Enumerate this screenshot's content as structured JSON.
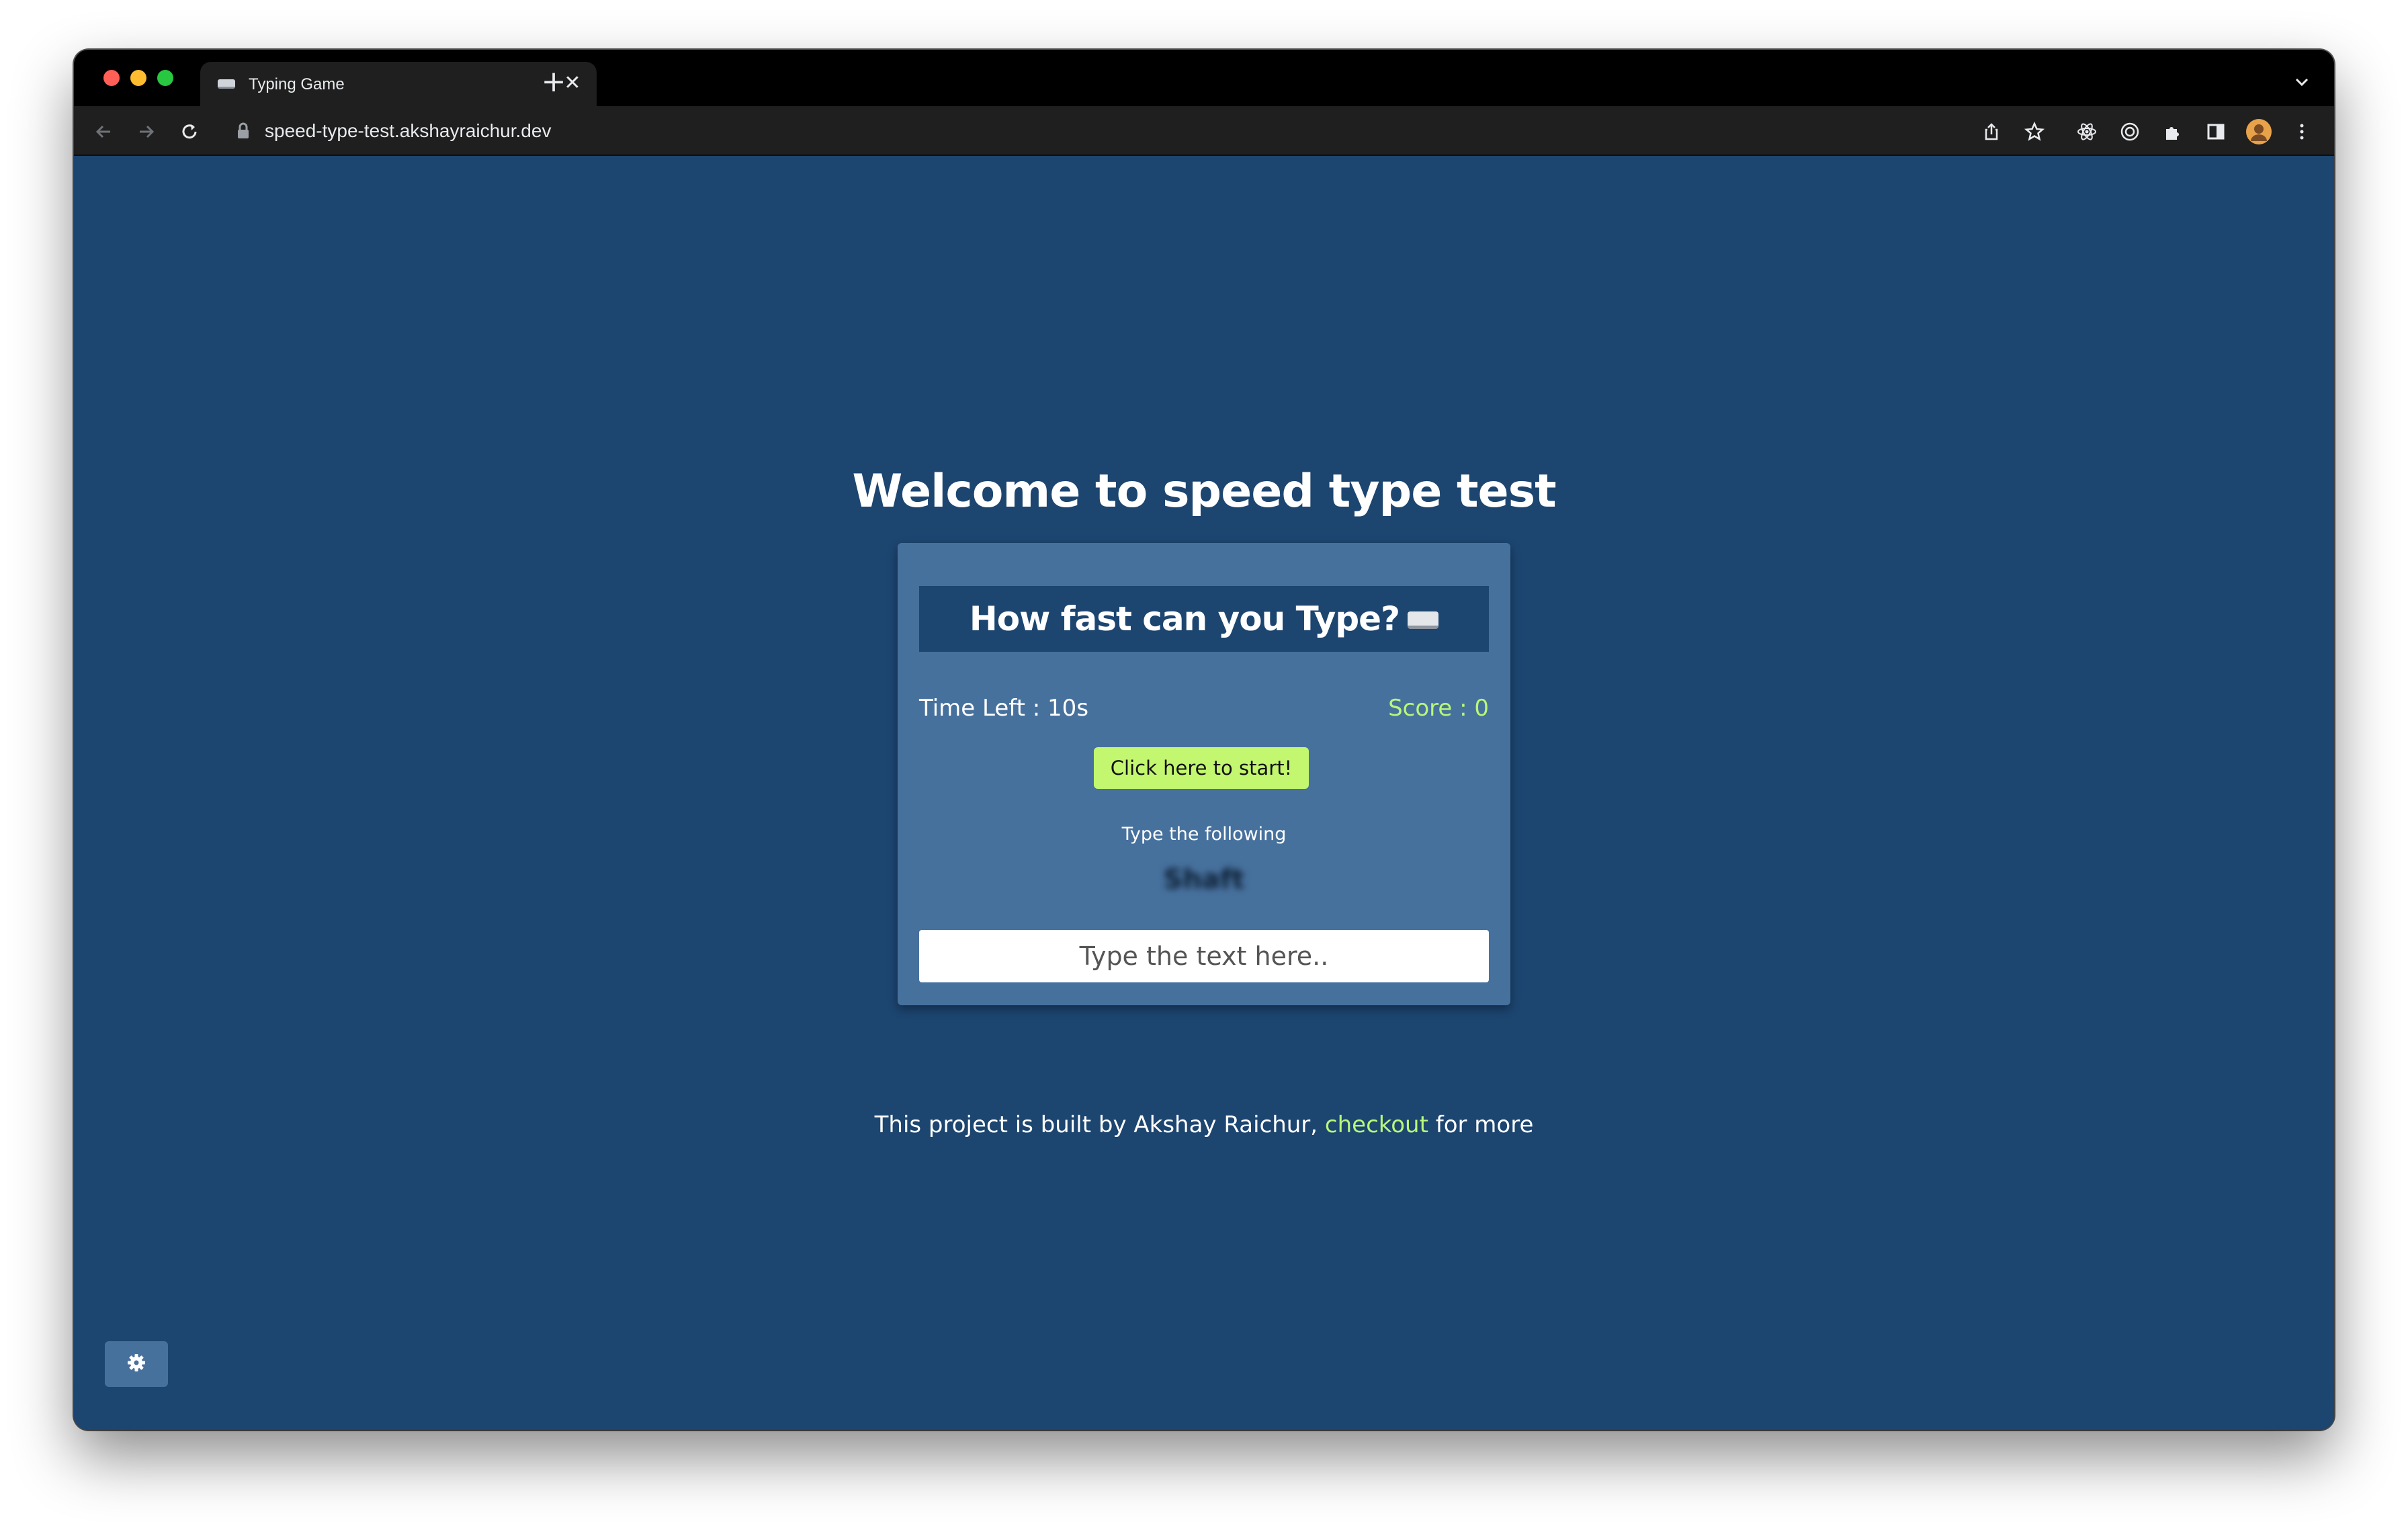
{
  "browser": {
    "tab": {
      "title": "Typing Game",
      "favicon": "keyboard-icon"
    },
    "address_bar": {
      "url": "speed-type-test.akshayraichur.dev"
    }
  },
  "page": {
    "heading": "Welcome to speed type test",
    "card": {
      "title": "How fast can you Type?",
      "title_icon": "keyboard-icon",
      "time_left": "Time Left : 10s",
      "score": "Score : 0",
      "start_button": "Click here to start!",
      "instruction": "Type the following",
      "target_word": "Shaft",
      "input_placeholder": "Type the text here.."
    },
    "footer": {
      "prefix": "This project is built by Akshay Raichur, ",
      "link": "checkout",
      "suffix": " for more"
    },
    "settings_icon": "gear-icon"
  },
  "colors": {
    "page_background": "#1c4570",
    "card_background": "#47719d",
    "accent_green": "#c3f76f",
    "score_text": "#b8f77a"
  }
}
